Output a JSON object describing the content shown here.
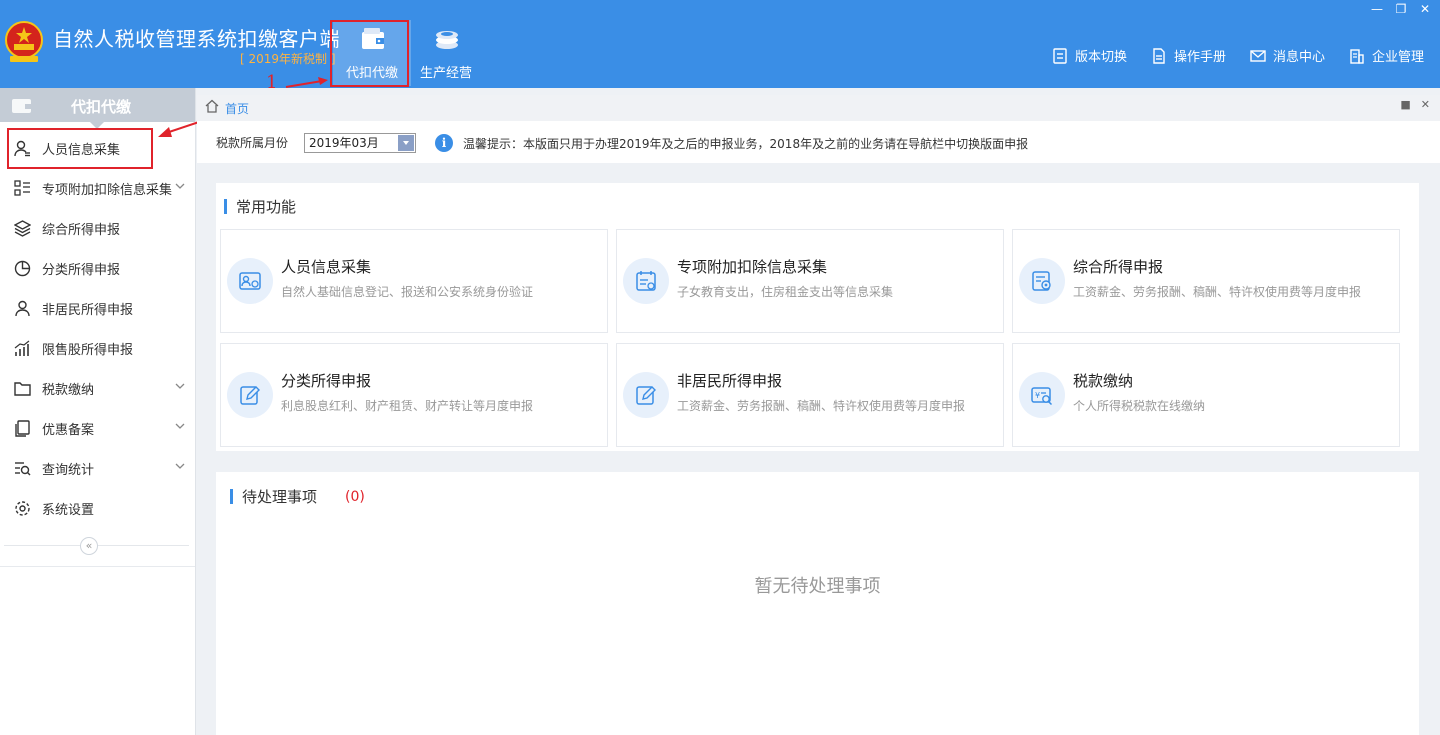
{
  "app": {
    "title": "自然人税收管理系统扣缴客户端",
    "subtitle": "[ 2019年新税制 ]"
  },
  "modules": [
    {
      "label": "代扣代缴",
      "icon": "wallet-icon",
      "active": true
    },
    {
      "label": "生产经营",
      "icon": "coins-icon",
      "active": false
    }
  ],
  "window_controls": [
    "minimize",
    "restore",
    "close"
  ],
  "toolbar": [
    {
      "label": "版本切换",
      "icon": "version-switch-icon"
    },
    {
      "label": "操作手册",
      "icon": "manual-icon"
    },
    {
      "label": "消息中心",
      "icon": "mail-icon"
    },
    {
      "label": "企业管理",
      "icon": "building-icon"
    }
  ],
  "annotations": {
    "first": "1",
    "second": "2",
    "color": "#e0232b"
  },
  "sidebar": {
    "title": "代扣代缴",
    "items": [
      {
        "label": "人员信息采集",
        "icon": "person-info-icon",
        "expandable": false
      },
      {
        "label": "专项附加扣除信息采集",
        "icon": "list-grid-icon",
        "expandable": true
      },
      {
        "label": "综合所得申报",
        "icon": "layers-icon",
        "expandable": false
      },
      {
        "label": "分类所得申报",
        "icon": "pie-chart-icon",
        "expandable": false
      },
      {
        "label": "非居民所得申报",
        "icon": "user-icon",
        "expandable": false
      },
      {
        "label": "限售股所得申报",
        "icon": "bar-trend-icon",
        "expandable": false
      },
      {
        "label": "税款缴纳",
        "icon": "folder-icon",
        "expandable": true
      },
      {
        "label": "优惠备案",
        "icon": "copy-icon",
        "expandable": true
      },
      {
        "label": "查询统计",
        "icon": "search-list-icon",
        "expandable": true
      },
      {
        "label": "系统设置",
        "icon": "gear-icon",
        "expandable": false
      }
    ],
    "collapse_glyph": "«"
  },
  "breadcrumb": {
    "home": "首页"
  },
  "filter": {
    "label": "税款所属月份",
    "month": "2019年03月",
    "tip": "温馨提示：本版面只用于办理2019年及之后的申报业务，2018年及之前的业务请在导航栏中切换版面申报",
    "info_glyph": "i"
  },
  "functions": {
    "title": "常用功能",
    "cards": [
      {
        "title": "人员信息采集",
        "desc": "自然人基础信息登记、报送和公安系统身份验证",
        "icon": "id-card-icon"
      },
      {
        "title": "专项附加扣除信息采集",
        "desc": "子女教育支出，住房租金支出等信息采集",
        "icon": "tax-calendar-icon"
      },
      {
        "title": "综合所得申报",
        "desc": "工资薪金、劳务报酬、稿酬、特许权使用费等月度申报",
        "icon": "form-check-icon"
      },
      {
        "title": "分类所得申报",
        "desc": "利息股息红利、财产租赁、财产转让等月度申报",
        "icon": "edit-icon"
      },
      {
        "title": "非居民所得申报",
        "desc": "工资薪金、劳务报酬、稿酬、特许权使用费等月度申报",
        "icon": "edit-icon"
      },
      {
        "title": "税款缴纳",
        "desc": "个人所得税税款在线缴纳",
        "icon": "yen-search-icon"
      }
    ]
  },
  "pending": {
    "title": "待处理事项",
    "count": "(0)",
    "empty": "暂无待处理事项"
  },
  "colors": {
    "primary": "#3a8ee6",
    "accent_orange": "#ffb340",
    "alert_red": "#e0232b"
  }
}
